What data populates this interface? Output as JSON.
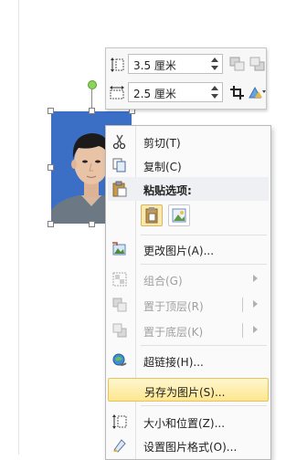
{
  "toolbar": {
    "height_value": "3.5 厘米",
    "width_value": "2.5 厘米"
  },
  "context_menu": {
    "items": [
      {
        "label": "剪切(T)",
        "icon": "scissors-icon",
        "enabled": true
      },
      {
        "label": "复制(C)",
        "icon": "copy-icon",
        "enabled": true
      },
      {
        "label": "粘贴选项:",
        "icon": "paste-icon",
        "enabled": true
      },
      {
        "label": "更改图片(A)...",
        "icon": "change-picture-icon",
        "enabled": true
      },
      {
        "label": "组合(G)",
        "icon": "group-icon",
        "enabled": false
      },
      {
        "label": "置于顶层(R)",
        "icon": "bring-to-front-icon",
        "enabled": false
      },
      {
        "label": "置于底层(K)",
        "icon": "send-to-back-icon",
        "enabled": false
      },
      {
        "label": "超链接(H)...",
        "icon": "hyperlink-icon",
        "enabled": true
      },
      {
        "label": "另存为图片(S)...",
        "icon": "",
        "enabled": true,
        "highlighted": true
      },
      {
        "label": "大小和位置(Z)...",
        "icon": "size-position-icon",
        "enabled": true
      },
      {
        "label": "设置图片格式(O)...",
        "icon": "format-picture-icon",
        "enabled": true
      }
    ]
  },
  "colors": {
    "photo_background": "#3b6fc6",
    "highlight": "#fde78f"
  }
}
